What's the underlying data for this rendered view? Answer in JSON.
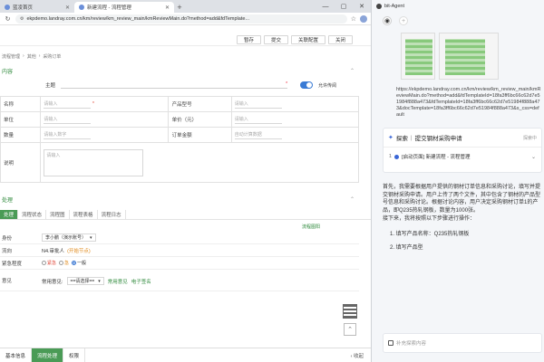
{
  "browser": {
    "tabs": [
      {
        "label": "蓝凌首页"
      },
      {
        "label": "新建流程 - 流程管理"
      }
    ],
    "url": "ekpdemo.landray.com.cn/km/review/km_review_main/kmReviewMain.do?method=add&fdTemplate...",
    "window_controls": {
      "min": "—",
      "max": "▢",
      "close": "✕"
    }
  },
  "toolbar": {
    "buttons": [
      "暂存",
      "提交",
      "关联配置",
      "关闭"
    ]
  },
  "breadcrumb": {
    "items": [
      "流程管理",
      "›",
      "其他",
      "›",
      "采购订单"
    ]
  },
  "form": {
    "section_title": "内容",
    "subject_label": "主题",
    "toggle_label": "允许传阅",
    "rows": [
      {
        "k1": "名称",
        "p1": "请输入",
        "k2": "产品型号",
        "p2": "请输入"
      },
      {
        "k1": "单位",
        "p1": "请输入",
        "k2": "单价（元）",
        "p2": "请输入"
      },
      {
        "k1": "数量",
        "p1": "请输入数字",
        "k2": "订单金额",
        "p2": "自动计算数据"
      }
    ],
    "remark_label": "说明",
    "remark_placeholder": "请输入"
  },
  "process": {
    "title": "处理",
    "tabs": [
      "处理",
      "流程状态",
      "流程图",
      "流程表格",
      "流程日志"
    ],
    "flowchart_link": "流程图阳",
    "identity_label": "身份",
    "identity_value": "李小鹏（演示账号）",
    "next_label": "流向",
    "next_value": "N4.审批人",
    "next_tag": "(开始节点)",
    "urgency_label": "紧急程度",
    "urgency_options": [
      "紧急",
      "急",
      "一般"
    ],
    "opinion_label": "意见",
    "opinion_common": "常用意见:",
    "opinion_select": "==请选择==",
    "opinion_link1": "常用意见",
    "opinion_link2": "电子签名"
  },
  "bottom_bar": {
    "buttons": [
      "基本信息",
      "流程处理",
      "权限"
    ],
    "fold": "收起"
  },
  "agent": {
    "title": "bit-Agent",
    "add_icon": "+",
    "url_text": "https://ekpdemo.landray.com.cn/km/review/km_review_main/kmReviewMain.do?method=add&fdTemplateId=18fa3ff6bc66c62d7e51984f888a473&fdTemplateId=18fa3ff6bc66c62d7e51984f888a473&docTemplate=18fa3ff6bc66c62d7e51984f888a473&s_css=default",
    "card_label": "探索",
    "card_sep": "|",
    "card_title": "提交钢材采购申请",
    "card_more": "探索中",
    "step_num": "1",
    "step_text": "[启动页面] 新建流程 - 流程管理",
    "reply_intro": "首先，我需要根据用户提供的钢材订单信息和采购讨论，填写并提交钢材采购申请。用户上传了两个文件，其中包含了钢材的产品型号信息和采购讨论。根据讨论内容，用户决定采购钢材订单1的产品，即Q235热轧钢板，数量为1000张。",
    "reply_next": "接下来，我将按照以下步骤进行操作：",
    "steps": [
      "1. 填写产品名称：Q235热轧钢板",
      "2. 填写产品型"
    ],
    "input_placeholder": "补充探索内容"
  }
}
